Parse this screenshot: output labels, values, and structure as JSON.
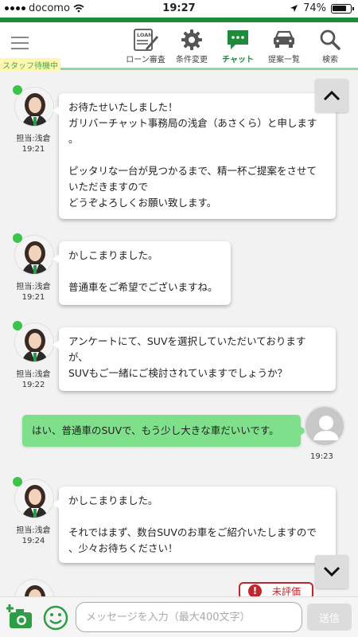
{
  "status_bar": {
    "carrier": "docomo",
    "time": "19:27",
    "battery": "74%"
  },
  "header": {
    "staff_status": "スタッフ待機中",
    "nav": [
      {
        "label": "ローン審査",
        "icon": "loan-document-icon",
        "icon_text": "LOAN"
      },
      {
        "label": "条件変更",
        "icon": "gear-icon"
      },
      {
        "label": "チャット",
        "icon": "chat-icon",
        "active": true
      },
      {
        "label": "提案一覧",
        "icon": "car-icon"
      },
      {
        "label": "検索",
        "icon": "search-icon"
      }
    ]
  },
  "messages": [
    {
      "agent": "担当:浅倉",
      "time": "19:21",
      "text": "お待たせいたしました！\nガリバーチャット事務局の浅倉（あさくら）と申します\n。\n\nピッタリな一台が見つかるまで、精一杯ご提案をさせて\nいただきますので\nどうぞよろしくお願い致します。"
    },
    {
      "agent": "担当:浅倉",
      "time": "19:21",
      "text": "かしこまりました。\n\n普通車をご希望でございますね。"
    },
    {
      "agent": "担当:浅倉",
      "time": "19:22",
      "text": "アンケートにて、SUVを選択していただいております\nが、\nSUVもご一緒にご検討されていますでしょうか？"
    },
    {
      "agent": "担当:浅倉",
      "time": "19:24",
      "text": "かしこまりました。\n\nそれではまず、数台SUVのお車をご紹介いたしますので\n、少々お待ちください！"
    }
  ],
  "user_message": {
    "text": "はい、普通車のSUVで、もう少し大きな車だいいです。",
    "time": "19:23"
  },
  "review_badge": {
    "icon_text": "!",
    "label": "未評価"
  },
  "input": {
    "placeholder": "メッセージを入力（最大400文字）",
    "send_label": "送信"
  },
  "colors": {
    "brand_green": "#1f8a3a",
    "user_bubble": "#7ee08a",
    "online": "#3cc44a",
    "alert_red": "#c0272d"
  }
}
